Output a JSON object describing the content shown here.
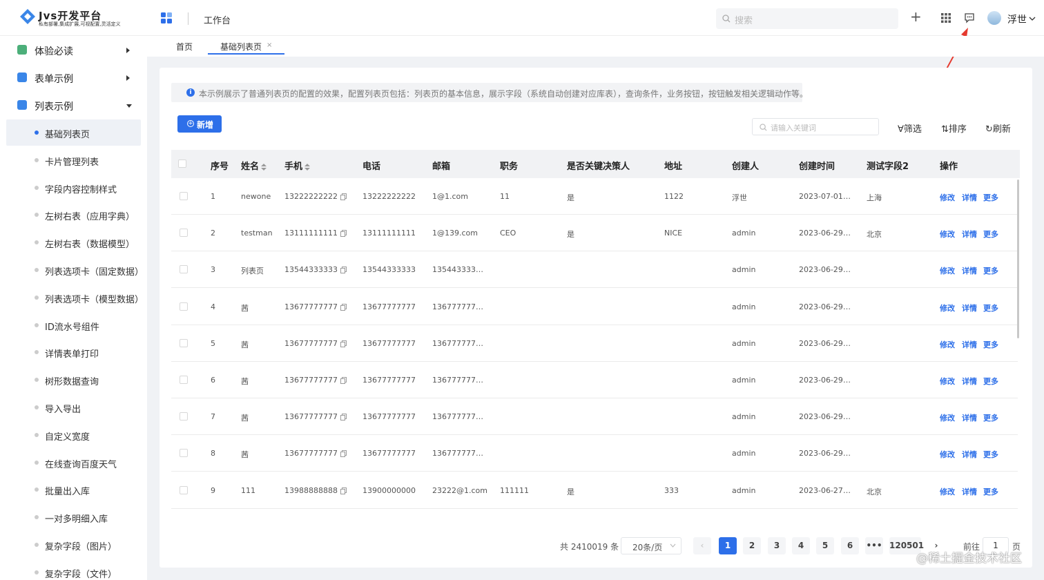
{
  "app": {
    "title": "Jvs开发平台",
    "subtitle": "私有部署,集成扩展,可视配置,灵活定义"
  },
  "header": {
    "workbench": "工作台",
    "search_placeholder": "搜索",
    "user_name": "浮世"
  },
  "sidebar": {
    "groups": [
      {
        "label": "体验必读",
        "icon": "book-icon",
        "color": "#4caf7a"
      },
      {
        "label": "表单示例",
        "icon": "folder-icon",
        "color": "#3a86e8"
      },
      {
        "label": "列表示例",
        "icon": "list-icon",
        "color": "#3a86e8"
      }
    ],
    "items": [
      "基础列表页",
      "卡片管理列表",
      "字段内容控制样式",
      "左树右表（应用字典）",
      "左树右表（数据模型）",
      "列表选项卡（固定数据）",
      "列表选项卡（模型数据）",
      "ID流水号组件",
      "详情表单打印",
      "树形数据查询",
      "导入导出",
      "自定义宽度",
      "在线查询百度天气",
      "批量出入库",
      "一对多明细入库",
      "复杂字段（图片）",
      "复杂字段（文件）"
    ]
  },
  "tabs": [
    "首页",
    "基础列表页"
  ],
  "notice": "本示例展示了普通列表页的配置的效果，配置列表页包括：列表页的基本信息，展示字段（系统自动创建对应库表），查询条件，业务按钮，按钮触发相关逻辑动作等。",
  "toolbar": {
    "add": "新增",
    "keyword_placeholder": "请输入关键词",
    "filter": "筛选",
    "sort": "排序",
    "refresh": "刷新"
  },
  "table": {
    "columns": [
      "序号",
      "姓名",
      "手机",
      "电话",
      "邮箱",
      "职务",
      "是否关键决策人",
      "地址",
      "创建人",
      "创建时间",
      "测试字段2",
      "操作"
    ],
    "actions": [
      "修改",
      "详情",
      "更多"
    ],
    "rows": [
      [
        "1",
        "newone",
        "13222222222",
        "13222222222",
        "1@1.com",
        "11",
        "是",
        "1122",
        "浮世",
        "2023-07-01 2...",
        "上海"
      ],
      [
        "2",
        "testman",
        "13111111111",
        "13111111111",
        "1@139.com",
        "CEO",
        "是",
        "NICE",
        "admin",
        "2023-06-29 2...",
        "北京"
      ],
      [
        "3",
        "列表页",
        "13544333333",
        "13544333333",
        "13544333333...",
        "",
        "",
        "",
        "admin",
        "2023-06-29 1...",
        ""
      ],
      [
        "4",
        "茜",
        "13677777777",
        "13677777777",
        "13677777777...",
        "",
        "",
        "",
        "admin",
        "2023-06-29 1...",
        ""
      ],
      [
        "5",
        "茜",
        "13677777777",
        "13677777777",
        "13677777777...",
        "",
        "",
        "",
        "admin",
        "2023-06-29 1...",
        ""
      ],
      [
        "6",
        "茜",
        "13677777777",
        "13677777777",
        "13677777777...",
        "",
        "",
        "",
        "admin",
        "2023-06-29 1...",
        ""
      ],
      [
        "7",
        "茜",
        "13677777777",
        "13677777777",
        "13677777777...",
        "",
        "",
        "",
        "admin",
        "2023-06-29 1...",
        ""
      ],
      [
        "8",
        "茜",
        "13677777777",
        "13677777777",
        "13677777777...",
        "",
        "",
        "",
        "admin",
        "2023-06-29 1...",
        ""
      ],
      [
        "9",
        "111",
        "13988888888",
        "13900000000",
        "23222@1.com",
        "111111",
        "是",
        "333",
        "admin",
        "2023-06-27 1...",
        "北京"
      ]
    ]
  },
  "pagination": {
    "total": "共 2410019 条",
    "page_size": "20条/页",
    "pages": [
      "1",
      "2",
      "3",
      "4",
      "5",
      "6",
      "•••",
      "120501"
    ],
    "goto_label": "前往",
    "goto_value": "1",
    "page_label": "页"
  },
  "watermark": "@稀土掘金技术社区",
  "colors": {
    "accent": "#2d6fe9"
  }
}
